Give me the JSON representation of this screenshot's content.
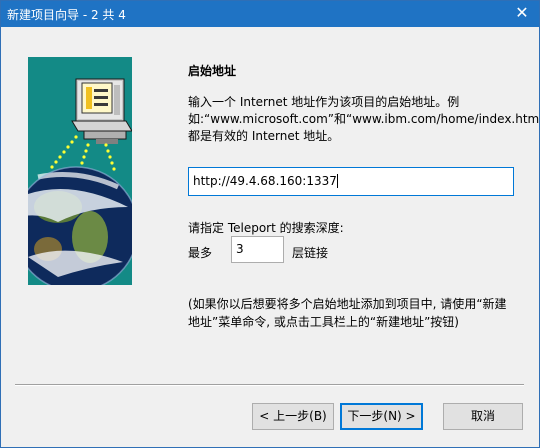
{
  "window": {
    "title": "新建项目向导 - 2 共 4",
    "close_glyph": "✕"
  },
  "page": {
    "heading": "启始地址",
    "description": "输入一个 Internet 地址作为该项目的启始地址。例如:“www.microsoft.com”和“www.ibm.com/home/index.htm”\n都是有效的 Internet 地址。"
  },
  "url_field": {
    "value": "http://49.4.68.160:1337"
  },
  "depth": {
    "label": "请指定 Teleport 的搜索深度:",
    "max_label": "最多",
    "value": "3",
    "unit_label": "层链接"
  },
  "note": "(如果你以后想要将多个启始地址添加到项目中, 请使用“新建地址”菜单命令, 或点击工具栏上的“新建地址”按钮)",
  "buttons": {
    "back": "< 上一步(B)",
    "next": "下一步(N) >",
    "cancel": "取消"
  },
  "art": {
    "icons": [
      "computer-icon",
      "earth-globe-icon"
    ],
    "background_color": "#138a86"
  },
  "colors": {
    "titlebar": "#1f73c4",
    "focus_border": "#0078d7"
  }
}
